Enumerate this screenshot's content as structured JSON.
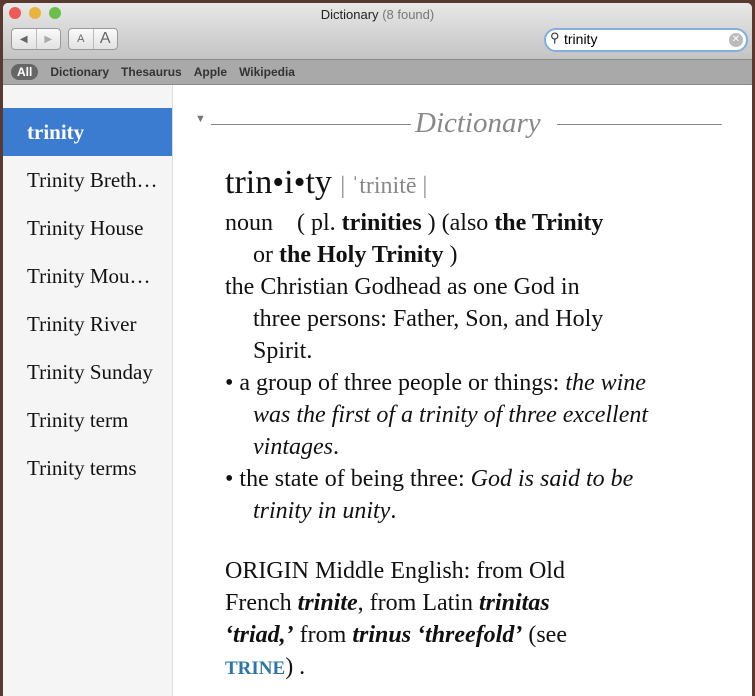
{
  "window": {
    "title": "Dictionary",
    "found": "(8 found)",
    "colors": {
      "close": "#ec5b55",
      "minimize": "#e9b33e",
      "zoom": "#6cc04a"
    }
  },
  "toolbar": {
    "back_icon": "triangle-left",
    "forward_icon": "triangle-right",
    "font_small": "A",
    "font_large": "A"
  },
  "search": {
    "value": "trinity",
    "icon": "magnifier-icon",
    "clear_icon": "x-circle-icon"
  },
  "scopes": [
    "All",
    "Dictionary",
    "Thesaurus",
    "Apple",
    "Wikipedia"
  ],
  "sidebar": {
    "items": [
      "trinity",
      "Trinity Breth…",
      "Trinity House",
      "Trinity Mou…",
      "Trinity River",
      "Trinity Sunday",
      "Trinity term",
      "Trinity terms"
    ]
  },
  "entry": {
    "section": "Dictionary",
    "headword": "trin•i•ty",
    "pronunciation": "| ˈtrinitē |",
    "pos": "noun",
    "l1": {
      "a": "( pl. ",
      "b": "trinities",
      "c": " ) (also ",
      "d": "the Trinity"
    },
    "l2": {
      "a": "or ",
      "b": "the Holy Trinity",
      "c": " )"
    },
    "def1": [
      "the Christian Godhead as one God in",
      "three persons: Father, Son, and Holy",
      "Spirit."
    ],
    "def2": {
      "text": "• a group of three people or things: ",
      "ex1": "the wine",
      "ex2": "was the first of a trinity of three excellent",
      "ex3": "vintages",
      "end": "."
    },
    "def3": {
      "text": "• the state of being three: ",
      "ex1": "God is said to be",
      "ex2": "trinity in unity",
      "end": "."
    },
    "origin": {
      "l1": "ORIGIN Middle English: from Old",
      "l2a": "French ",
      "l2b": "trinite",
      ", from Latin ": "",
      "l2c": ", from Latin ",
      "l2d": "trinitas",
      "l3a": "‘triad,’",
      "l3b": " from ",
      "l3c": "trinus ‘threefold’",
      "l3d": " (see",
      "link": "TRINE",
      "l4end": ") ."
    }
  }
}
